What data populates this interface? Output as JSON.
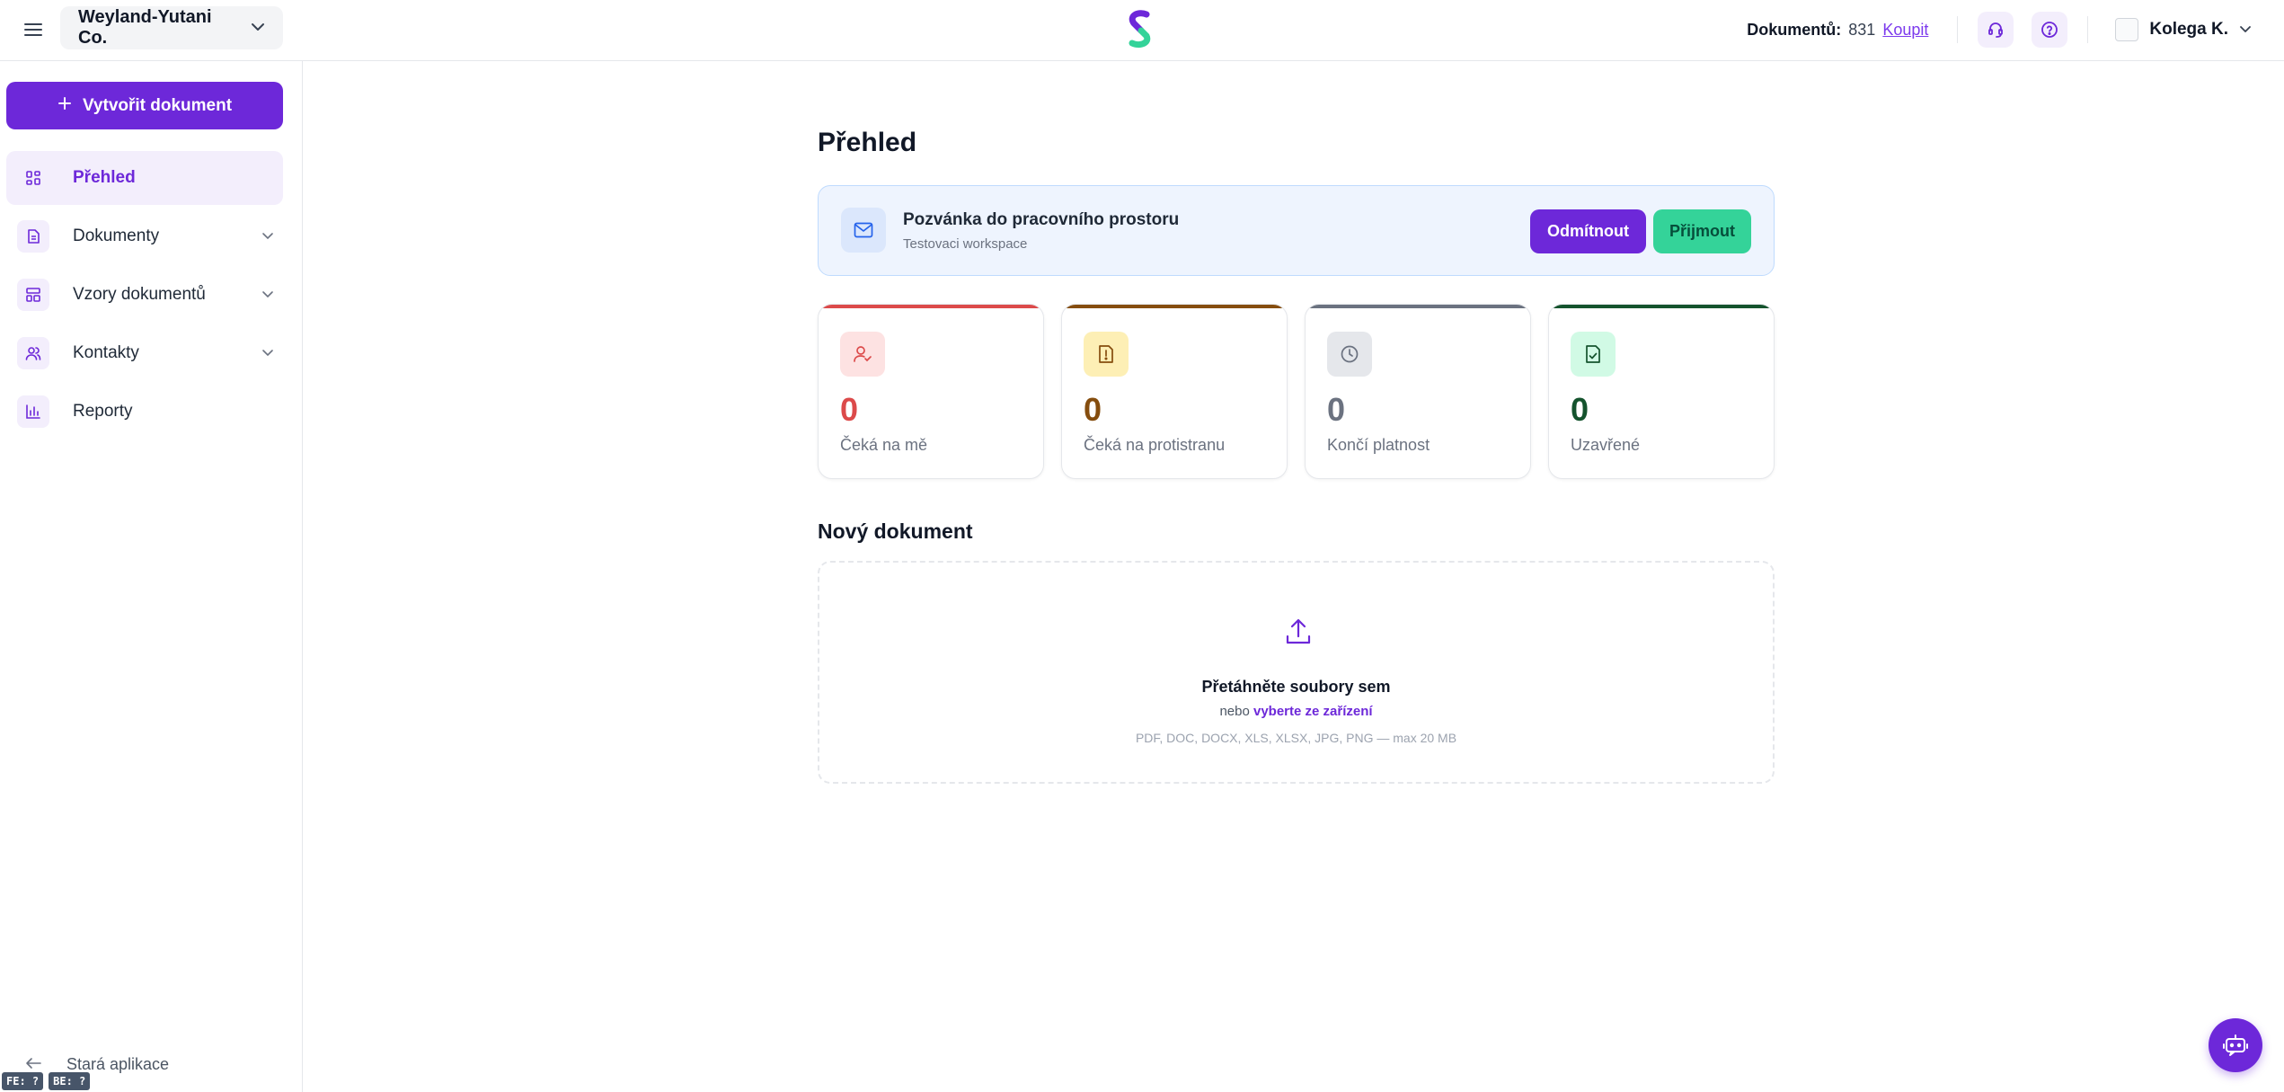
{
  "header": {
    "org_name": "Weyland-Yutani Co.",
    "doc_count_label": "Dokumentů:",
    "doc_count_value": "831",
    "buy_label": "Koupit",
    "user_name": "Kolega K."
  },
  "sidebar": {
    "create_label": "Vytvořit dokument",
    "items": [
      {
        "label": "Přehled",
        "icon": "grid-icon",
        "active": true
      },
      {
        "label": "Dokumenty",
        "icon": "document-icon",
        "expandable": true
      },
      {
        "label": "Vzory dokumentů",
        "icon": "template-icon",
        "expandable": true
      },
      {
        "label": "Kontakty",
        "icon": "users-icon",
        "expandable": true
      },
      {
        "label": "Reporty",
        "icon": "bar-chart-icon"
      }
    ],
    "old_app_label": "Stará aplikace",
    "debug_badges": [
      "FE: ?",
      "BE: ?"
    ]
  },
  "main": {
    "title": "Přehled",
    "invite": {
      "title": "Pozvánka do pracovního prostoru",
      "subtitle": "Testovaci workspace",
      "decline_label": "Odmítnout",
      "accept_label": "Přijmout"
    },
    "stats": [
      {
        "value": "0",
        "label": "Čeká na mě",
        "color": "#dc4a4a",
        "icon": "user-check-icon"
      },
      {
        "value": "0",
        "label": "Čeká na protistranu",
        "color": "#854d0e",
        "icon": "alert-file-icon"
      },
      {
        "value": "0",
        "label": "Končí platnost",
        "color": "#6b7280",
        "icon": "clock-icon"
      },
      {
        "value": "0",
        "label": "Uzavřené",
        "color": "#14532d",
        "icon": "file-check-icon"
      }
    ],
    "new_doc": {
      "title": "Nový dokument",
      "drop_title": "Přetáhněte soubory sem",
      "drop_or": "nebo",
      "drop_link": "vyberte ze zařízení",
      "drop_hint": "PDF, DOC, DOCX, XLS, XLSX, JPG, PNG — max 20 MB"
    }
  }
}
